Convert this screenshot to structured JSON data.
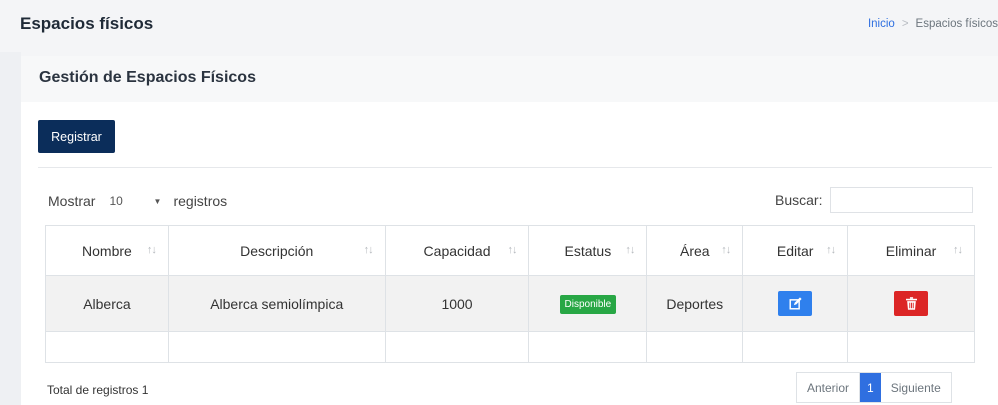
{
  "header": {
    "title": "Espacios físicos",
    "breadcrumb": {
      "home": "Inicio",
      "separator": ">",
      "current": "Espacios físicos"
    }
  },
  "card": {
    "title": "Gestión de Espacios Físicos",
    "register_label": "Registrar"
  },
  "table_controls": {
    "show_label": "Mostrar",
    "page_length": "10",
    "records_label": "registros",
    "search_label": "Buscar:",
    "search_value": ""
  },
  "table": {
    "columns": [
      "Nombre",
      "Descripción",
      "Capacidad",
      "Estatus",
      "Área",
      "Editar",
      "Eliminar"
    ],
    "sort_icon": "↑↓",
    "rows": [
      {
        "nombre": "Alberca",
        "descripcion": "Alberca semiolímpica",
        "capacidad": "1000",
        "estatus": "Disponible",
        "area": "Deportes",
        "edit_icon": "edit-icon",
        "delete_icon": "trash-icon"
      }
    ]
  },
  "footer": {
    "total_label": "Total de registros 1",
    "pagination": {
      "previous": "Anterior",
      "current_page": "1",
      "next": "Siguiente"
    }
  },
  "colors": {
    "primary_button": "#0b2d5a",
    "status_available": "#28a745",
    "edit_button": "#2f80ed",
    "delete_button": "#dc2626",
    "active_page": "#2f6fe0"
  }
}
